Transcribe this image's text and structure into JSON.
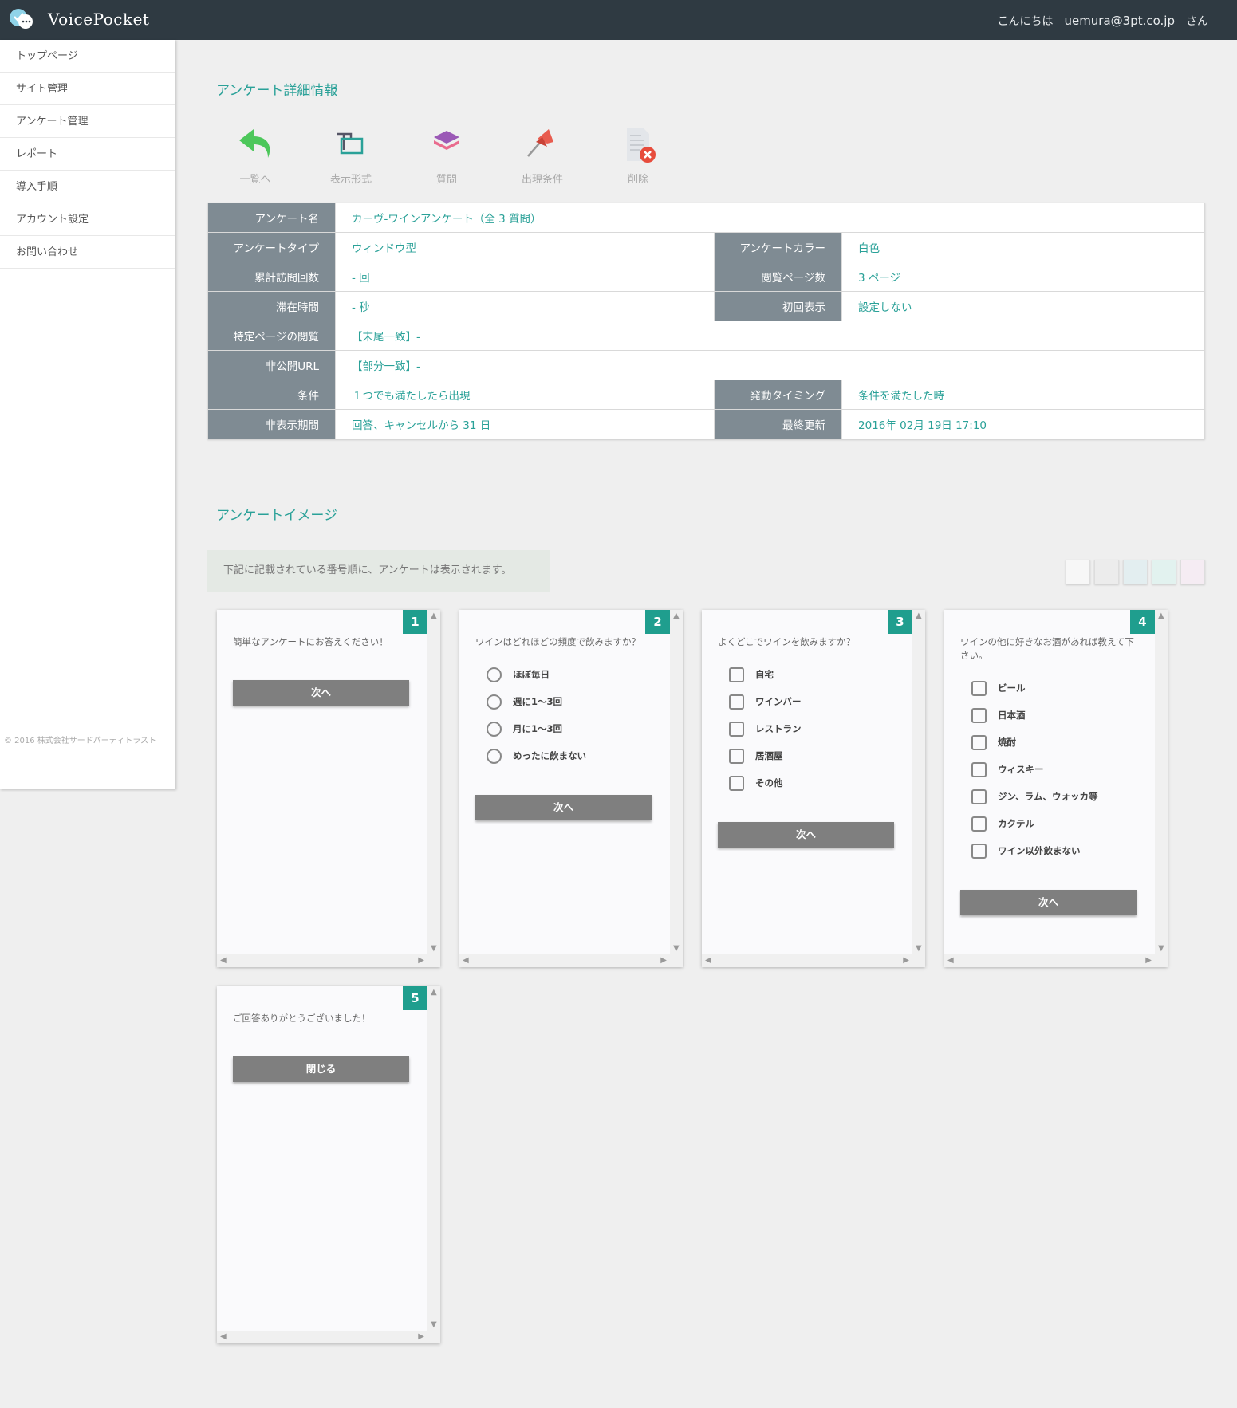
{
  "header": {
    "brand": "VoicePocket",
    "greeting_prefix": "こんにちは",
    "user": "uemura@3pt.co.jp",
    "greeting_suffix": "さん"
  },
  "sidebar": {
    "items": [
      "トップページ",
      "サイト管理",
      "アンケート管理",
      "レポート",
      "導入手順",
      "アカウント設定",
      "お問い合わせ"
    ],
    "copyright": "© 2016 株式会社サードパーティトラスト"
  },
  "detail": {
    "title": "アンケート詳細情報",
    "toolbar": {
      "back": "一覧へ",
      "display": "表示形式",
      "question": "質問",
      "condition": "出現条件",
      "delete": "削除",
      "icons": {
        "back": "undo-arrow-icon",
        "display": "text-frame-icon",
        "question": "layers-icon",
        "condition": "pin-icon",
        "delete": "delete-document-icon"
      }
    },
    "rows": {
      "name_label": "アンケート名",
      "name_value": "カーヴ-ワインアンケート（全 3 質問）",
      "type_label": "アンケートタイプ",
      "type_value": "ウィンドウ型",
      "color_label": "アンケートカラー",
      "color_value": "白色",
      "visits_label": "累計訪問回数",
      "visits_value": "- 回",
      "pages_label": "閲覧ページ数",
      "pages_value": "3 ページ",
      "stay_label": "滞在時間",
      "stay_value": "- 秒",
      "initial_label": "初回表示",
      "initial_value": "設定しない",
      "specific_label": "特定ページの閲覧",
      "specific_value": "【末尾一致】-",
      "private_label": "非公開URL",
      "private_value": "【部分一致】-",
      "cond_label": "条件",
      "cond_value": "１つでも満たしたら出現",
      "timing_label": "発動タイミング",
      "timing_value": "条件を満たした時",
      "hide_label": "非表示期間",
      "hide_value": "回答、キャンセルから 31 日",
      "updated_label": "最終更新",
      "updated_value": "2016年 02月 19日 17:10"
    }
  },
  "image_section": {
    "title": "アンケートイメージ",
    "notice": "下記に記載されている番号順に、アンケートは表示されます。",
    "swatch_colors": [
      "#f7f7f7",
      "#ececec",
      "#e3eef0",
      "#e2f2ef",
      "#f5ecf3"
    ]
  },
  "cards": [
    {
      "num": "1",
      "question": "簡単なアンケートにお答えください！",
      "options": [],
      "button": "次へ"
    },
    {
      "num": "2",
      "question": "ワインはどれほどの頻度で飲みますか？",
      "options": [
        "ほぼ毎日",
        "週に1～3回",
        "月に1～3回",
        "めったに飲まない"
      ],
      "button": "次へ"
    },
    {
      "num": "3",
      "question": "よくどこでワインを飲みますか？",
      "options": [
        "自宅",
        "ワインバー",
        "レストラン",
        "居酒屋",
        "その他"
      ],
      "button": "次へ"
    },
    {
      "num": "4",
      "question": "ワインの他に好きなお酒があれば教えて下さい。",
      "options": [
        "ビール",
        "日本酒",
        "焼酎",
        "ウィスキー",
        "ジン、ラム、ウォッカ等",
        "カクテル",
        "ワイン以外飲まない"
      ],
      "button": "次へ"
    },
    {
      "num": "5",
      "question": "ご回答ありがとうございました！",
      "options": [],
      "button": "閉じる"
    }
  ]
}
